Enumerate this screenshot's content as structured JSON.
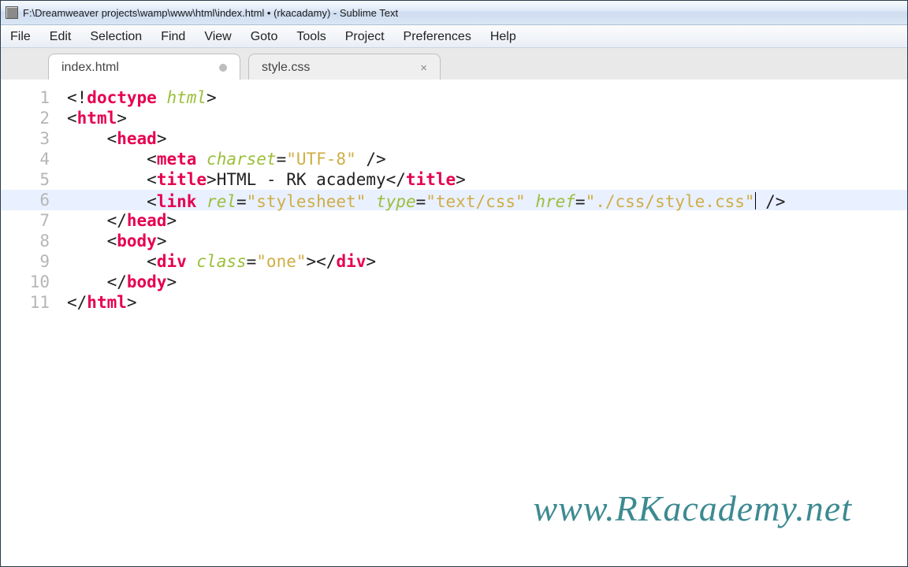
{
  "titlebar": {
    "title": "F:\\Dreamweaver projects\\wamp\\www\\html\\index.html • (rkacadamy) - Sublime Text"
  },
  "menu": {
    "items": [
      "File",
      "Edit",
      "Selection",
      "Find",
      "View",
      "Goto",
      "Tools",
      "Project",
      "Preferences",
      "Help"
    ]
  },
  "tabs": [
    {
      "label": "index.html",
      "dirty": true,
      "active": true
    },
    {
      "label": "style.css",
      "dirty": false,
      "active": false
    }
  ],
  "watermark": "www.RKacademy.net",
  "code": {
    "lines": [
      {
        "n": 1,
        "tokens": [
          {
            "t": "<!",
            "c": "p"
          },
          {
            "t": "doctype",
            "c": "tg"
          },
          {
            "t": " ",
            "c": "p"
          },
          {
            "t": "html",
            "c": "at"
          },
          {
            "t": ">",
            "c": "p"
          }
        ]
      },
      {
        "n": 2,
        "tokens": [
          {
            "t": "<",
            "c": "p"
          },
          {
            "t": "html",
            "c": "tg"
          },
          {
            "t": ">",
            "c": "p"
          }
        ]
      },
      {
        "n": 3,
        "indent": 1,
        "tokens": [
          {
            "t": "<",
            "c": "p"
          },
          {
            "t": "head",
            "c": "tg"
          },
          {
            "t": ">",
            "c": "p"
          }
        ]
      },
      {
        "n": 4,
        "indent": 2,
        "tokens": [
          {
            "t": "<",
            "c": "p"
          },
          {
            "t": "meta",
            "c": "tg"
          },
          {
            "t": " ",
            "c": "p"
          },
          {
            "t": "charset",
            "c": "at"
          },
          {
            "t": "=",
            "c": "p"
          },
          {
            "t": "\"UTF-8\"",
            "c": "st"
          },
          {
            "t": " />",
            "c": "p"
          }
        ]
      },
      {
        "n": 5,
        "indent": 2,
        "tokens": [
          {
            "t": "<",
            "c": "p"
          },
          {
            "t": "title",
            "c": "tg"
          },
          {
            "t": ">",
            "c": "p"
          },
          {
            "t": "HTML - RK academy",
            "c": "tx"
          },
          {
            "t": "</",
            "c": "p"
          },
          {
            "t": "title",
            "c": "tg"
          },
          {
            "t": ">",
            "c": "p"
          }
        ]
      },
      {
        "n": 6,
        "indent": 2,
        "hl": true,
        "tokens": [
          {
            "t": "<",
            "c": "p"
          },
          {
            "t": "link",
            "c": "tg"
          },
          {
            "t": " ",
            "c": "p"
          },
          {
            "t": "rel",
            "c": "at"
          },
          {
            "t": "=",
            "c": "p"
          },
          {
            "t": "\"stylesheet\"",
            "c": "st"
          },
          {
            "t": " ",
            "c": "p"
          },
          {
            "t": "type",
            "c": "at"
          },
          {
            "t": "=",
            "c": "p"
          },
          {
            "t": "\"text/css\"",
            "c": "st"
          },
          {
            "t": " ",
            "c": "p"
          },
          {
            "t": "href",
            "c": "at"
          },
          {
            "t": "=",
            "c": "p"
          },
          {
            "t": "\"./css/style.css\"",
            "c": "st"
          },
          {
            "t": "",
            "caret": true
          },
          {
            "t": " />",
            "c": "p"
          }
        ]
      },
      {
        "n": 7,
        "indent": 1,
        "tokens": [
          {
            "t": "</",
            "c": "p"
          },
          {
            "t": "head",
            "c": "tg"
          },
          {
            "t": ">",
            "c": "p"
          }
        ]
      },
      {
        "n": 8,
        "indent": 1,
        "tokens": [
          {
            "t": "<",
            "c": "p"
          },
          {
            "t": "body",
            "c": "tg"
          },
          {
            "t": ">",
            "c": "p"
          }
        ]
      },
      {
        "n": 9,
        "indent": 2,
        "tokens": [
          {
            "t": "<",
            "c": "p"
          },
          {
            "t": "div",
            "c": "tg"
          },
          {
            "t": " ",
            "c": "p"
          },
          {
            "t": "class",
            "c": "at"
          },
          {
            "t": "=",
            "c": "p"
          },
          {
            "t": "\"one\"",
            "c": "st"
          },
          {
            "t": "></",
            "c": "p"
          },
          {
            "t": "div",
            "c": "tg"
          },
          {
            "t": ">",
            "c": "p"
          }
        ]
      },
      {
        "n": 10,
        "indent": 1,
        "tokens": [
          {
            "t": "</",
            "c": "p"
          },
          {
            "t": "body",
            "c": "tg"
          },
          {
            "t": ">",
            "c": "p"
          }
        ]
      },
      {
        "n": 11,
        "tokens": [
          {
            "t": "</",
            "c": "p"
          },
          {
            "t": "html",
            "c": "tg"
          },
          {
            "t": ">",
            "c": "p"
          }
        ]
      }
    ]
  }
}
